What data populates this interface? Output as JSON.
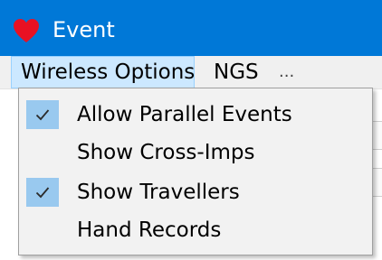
{
  "window": {
    "title": "Event",
    "icon": "heart-icon",
    "accent_color": "#0078d7",
    "icon_color": "#e81123"
  },
  "menubar": {
    "items": [
      {
        "label": "Wireless Options",
        "open": true
      },
      {
        "label": "NGS"
      },
      {
        "label": "..."
      }
    ]
  },
  "dropdown": {
    "items": [
      {
        "label": "Allow Parallel Events",
        "checked": true
      },
      {
        "label": "Show Cross-Imps",
        "checked": false
      },
      {
        "label": "Show Travellers",
        "checked": true
      },
      {
        "label": "Hand Records",
        "checked": false
      }
    ],
    "check_highlight_color": "#99c9ef"
  }
}
